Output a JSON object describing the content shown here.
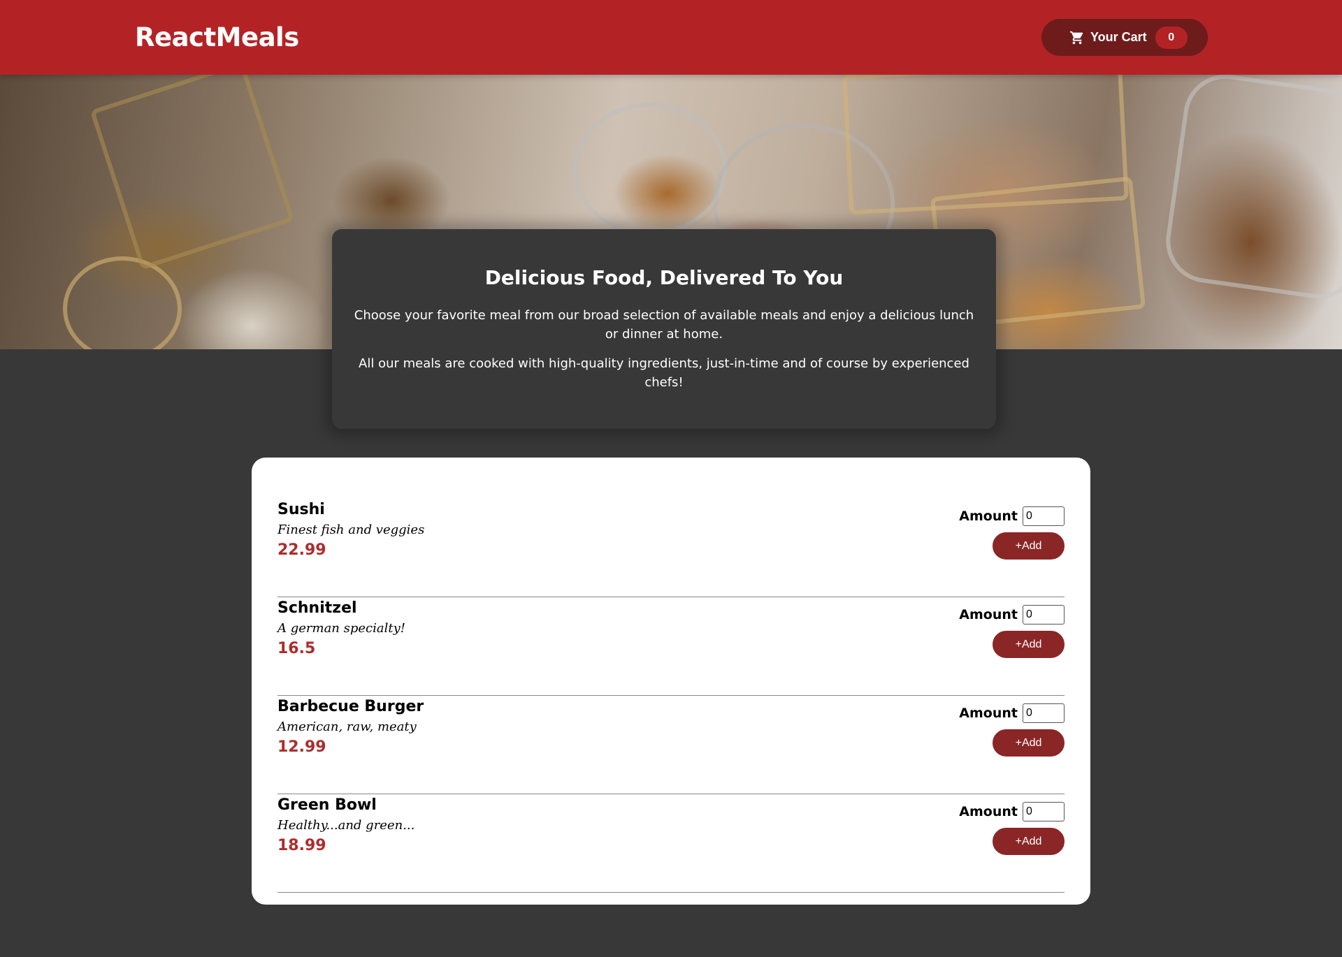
{
  "header": {
    "logo": "ReactMeals",
    "cart_label": "Your Cart",
    "cart_count": "0",
    "cart_icon": "cart-icon"
  },
  "hero": {
    "image_description": "buffet table with food trays"
  },
  "summary": {
    "title": "Delicious Food, Delivered To You",
    "paragraph1": "Choose your favorite meal from our broad selection of available meals and enjoy a delicious lunch or dinner at home.",
    "paragraph2": "All our meals are cooked with high-quality ingredients, just-in-time and of course by experienced chefs!"
  },
  "meals": [
    {
      "name": "Sushi",
      "description": "Finest fish and veggies",
      "price": "22.99",
      "amount_label": "Amount",
      "amount_value": "0",
      "add_label": "+Add"
    },
    {
      "name": "Schnitzel",
      "description": "A german specialty!",
      "price": "16.5",
      "amount_label": "Amount",
      "amount_value": "0",
      "add_label": "+Add"
    },
    {
      "name": "Barbecue Burger",
      "description": "American, raw, meaty",
      "price": "12.99",
      "amount_label": "Amount",
      "amount_value": "0",
      "add_label": "+Add"
    },
    {
      "name": "Green Bowl",
      "description": "Healthy...and green...",
      "price": "18.99",
      "amount_label": "Amount",
      "amount_value": "0",
      "add_label": "+Add"
    }
  ],
  "colors": {
    "header": "#b32325",
    "cart_button": "#6e1b1b",
    "background": "#383838",
    "price": "#ad2c2c",
    "add_button": "#8a2626"
  }
}
